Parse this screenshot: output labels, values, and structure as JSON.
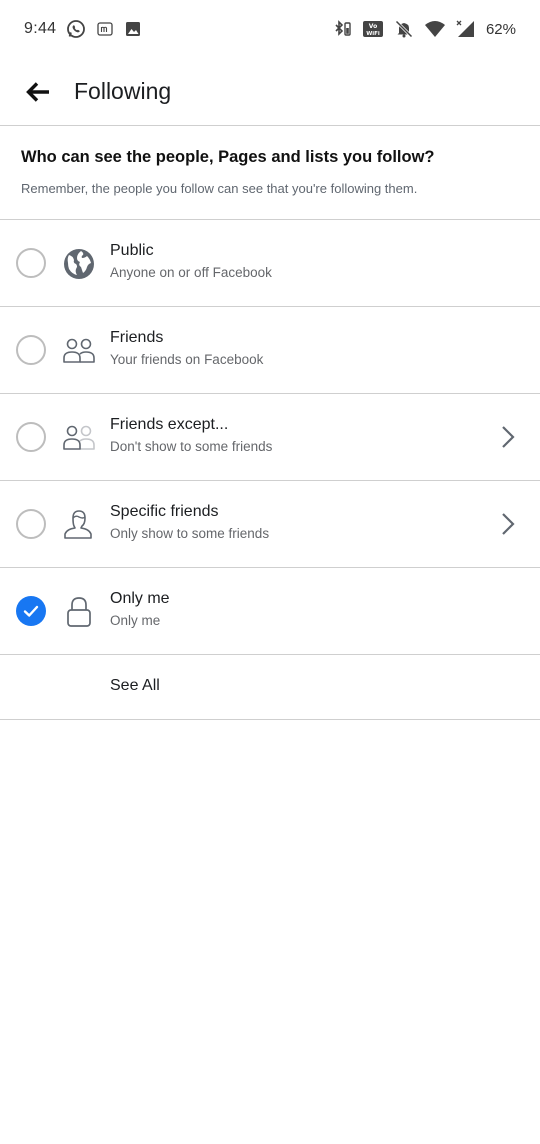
{
  "status_bar": {
    "time": "9:44",
    "battery": "62%",
    "left_icons": [
      "whatsapp-icon",
      "messenger-lite-icon",
      "gallery-icon"
    ],
    "right_icons": [
      "bluetooth-battery-icon",
      "vowifi-icon",
      "mute-bell-icon",
      "wifi-icon",
      "signal-icon"
    ],
    "vowifi_label": "VoWiFi"
  },
  "header": {
    "title": "Following",
    "back_icon": "arrow-left-icon"
  },
  "intro": {
    "heading": "Who can see the people, Pages and lists you follow?",
    "subtext": "Remember, the people you follow can see that you're following them."
  },
  "options": [
    {
      "label": "Public",
      "description": "Anyone on or off Facebook",
      "icon": "globe-icon",
      "selected": false,
      "has_chevron": false
    },
    {
      "label": "Friends",
      "description": "Your friends on Facebook",
      "icon": "friends-icon",
      "selected": false,
      "has_chevron": false
    },
    {
      "label": "Friends except...",
      "description": "Don't show to some friends",
      "icon": "friends-except-icon",
      "selected": false,
      "has_chevron": true
    },
    {
      "label": "Specific friends",
      "description": "Only show to some friends",
      "icon": "specific-friend-icon",
      "selected": false,
      "has_chevron": true
    },
    {
      "label": "Only me",
      "description": "Only me",
      "icon": "lock-icon",
      "selected": true,
      "has_chevron": false
    }
  ],
  "see_all": {
    "label": "See All"
  },
  "colors": {
    "accent": "#1877f2",
    "divider": "#cfcfcf",
    "secondary_text": "#65676b",
    "radio_border": "#bdbdbd"
  }
}
